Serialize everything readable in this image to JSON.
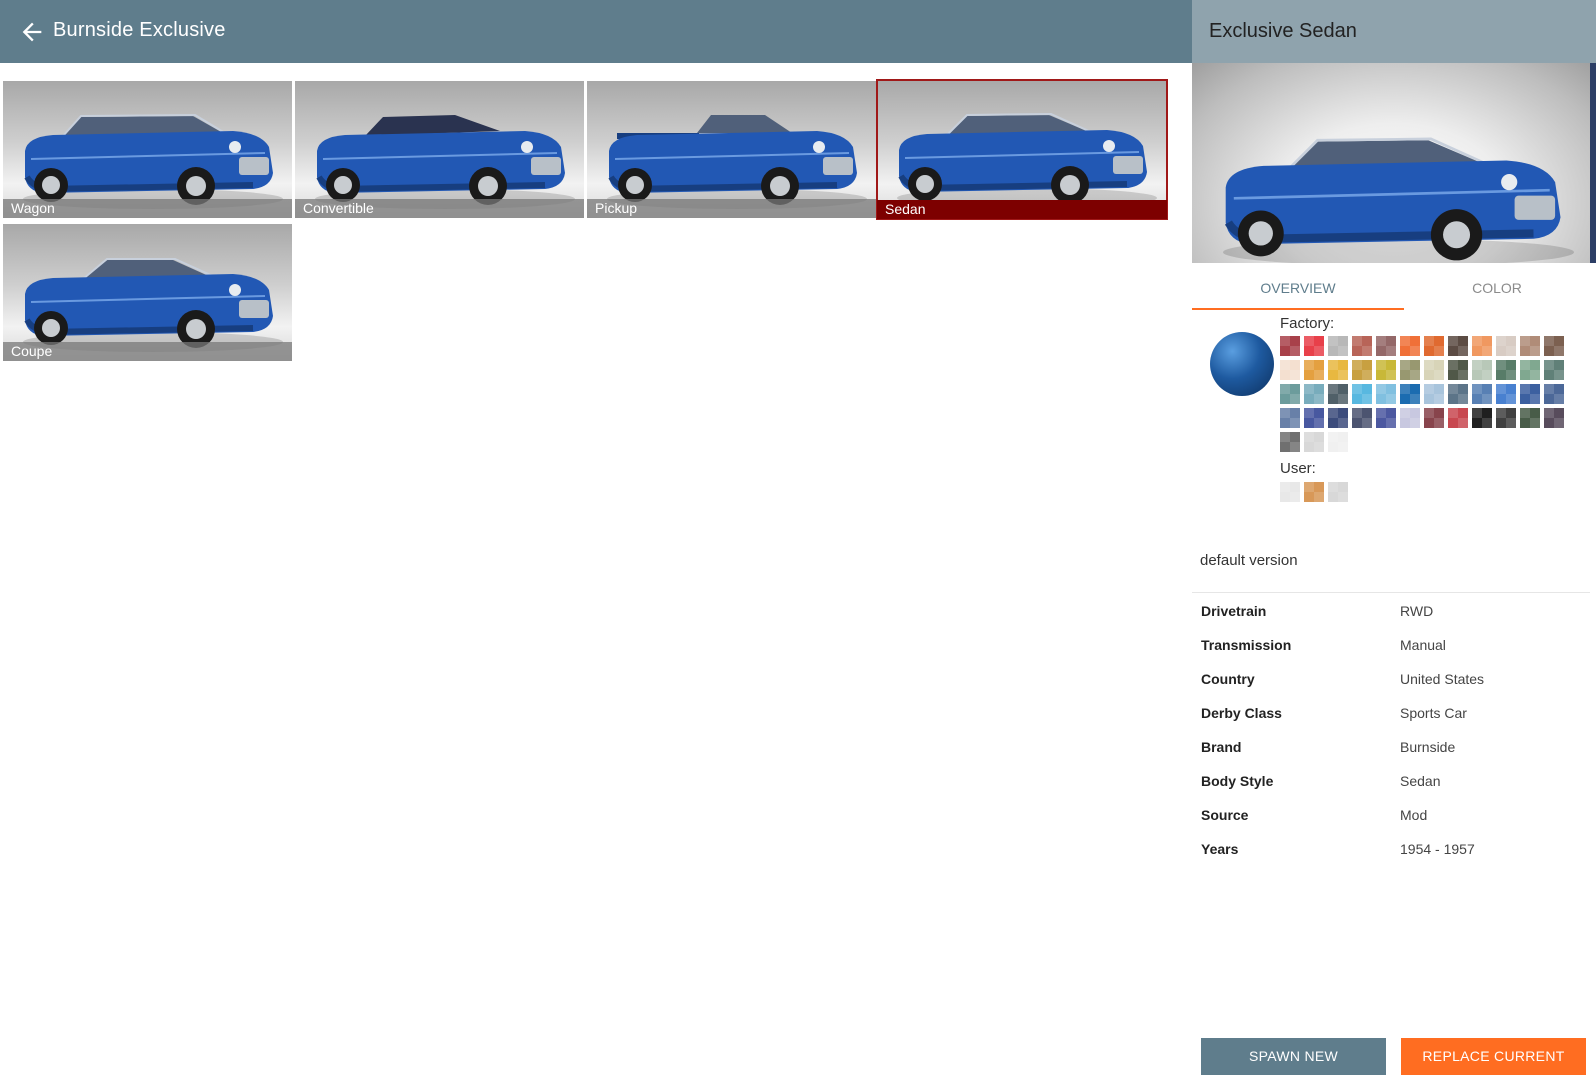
{
  "header": {
    "title": "Burnside Exclusive"
  },
  "configs": [
    {
      "label": "Wagon",
      "selected": false
    },
    {
      "label": "Convertible",
      "selected": false
    },
    {
      "label": "Pickup",
      "selected": false
    },
    {
      "label": "Sedan",
      "selected": true
    },
    {
      "label": "Coupe",
      "selected": false
    }
  ],
  "detail": {
    "title": "Exclusive Sedan",
    "tabs": {
      "overview": "OVERVIEW",
      "color": "COLOR"
    },
    "factory_label": "Factory:",
    "user_label": "User:",
    "current_color": "#1e5aa0",
    "version": "default version",
    "specs": [
      {
        "key": "Drivetrain",
        "value": "RWD"
      },
      {
        "key": "Transmission",
        "value": "Manual"
      },
      {
        "key": "Country",
        "value": "United States"
      },
      {
        "key": "Derby Class",
        "value": "Sports Car"
      },
      {
        "key": "Brand",
        "value": "Burnside"
      },
      {
        "key": "Body Style",
        "value": "Sedan"
      },
      {
        "key": "Source",
        "value": "Mod"
      },
      {
        "key": "Years",
        "value": "1954 - 1957"
      }
    ],
    "factory_colors": [
      "#a8414a",
      "#e8404a",
      "#b8b8b8",
      "#b86458",
      "#946868",
      "#f07038",
      "#e06a30",
      "#5c4c44",
      "#f09860",
      "#d8ccc4",
      "#b08c78",
      "#7c6050",
      "#f4e0d0",
      "#e4a040",
      "#e8b840",
      "#c8a040",
      "#c8b838",
      "#989870",
      "#d8d4b8",
      "#505848",
      "#b8c8b8",
      "#587c68",
      "#80a890",
      "#608078",
      "#6c9c9c",
      "#78acbc",
      "#506068",
      "#58b8e0",
      "#80c0e0",
      "#1c6cb0",
      "#a8c4dc",
      "#5c7488",
      "#5880b4",
      "#4880d0",
      "#3c60a0",
      "#4c6898",
      "#6880a8",
      "#4858a0",
      "#3c4c7c",
      "#4c5470",
      "#4c58a0",
      "#c8c8e0",
      "#88444c",
      "#c84850",
      "#202020",
      "#404040",
      "#485c48",
      "#584c5c",
      "#707070",
      "#d8d8d8",
      "#f0f0f0"
    ],
    "user_colors": [
      "#e8e8e8",
      "#d89858",
      "#d8d8d8"
    ],
    "buttons": {
      "spawn": "SPAWN NEW",
      "replace": "REPLACE CURRENT"
    }
  }
}
